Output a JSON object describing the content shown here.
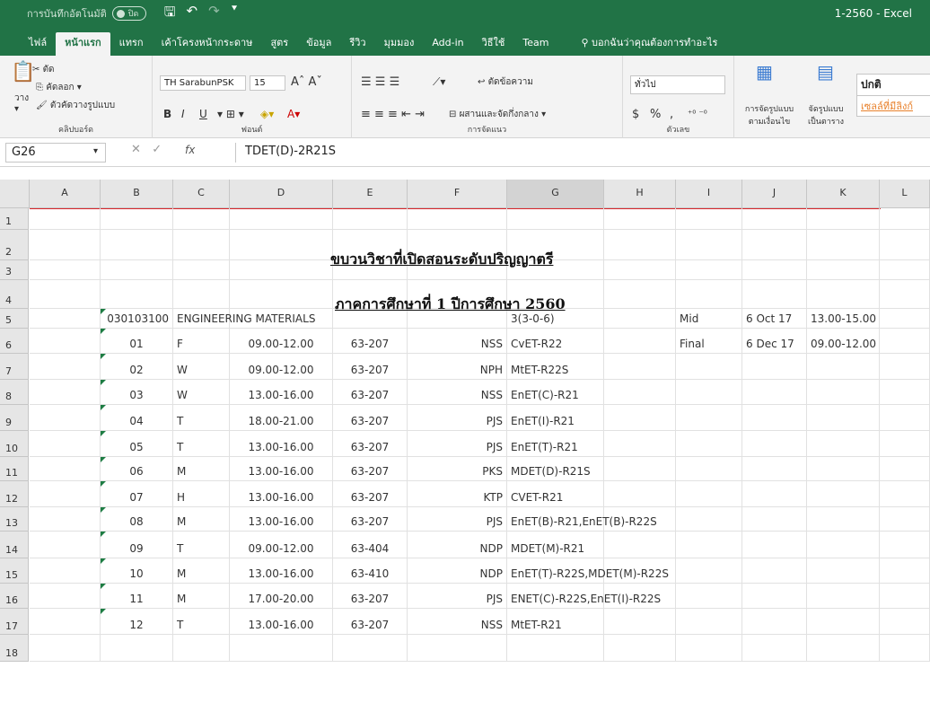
{
  "titlebar": {
    "autosave": "การบันทึกอัตโนมัติ",
    "autosave_state": "ปิด",
    "doc_title": "1-2560  -  Excel"
  },
  "tabs": [
    "ไฟล์",
    "หน้าแรก",
    "แทรก",
    "เค้าโครงหน้ากระดาษ",
    "สูตร",
    "ข้อมูล",
    "รีวิว",
    "มุมมอง",
    "Add-in",
    "วิธีใช้",
    "Team"
  ],
  "tell_me": "บอกฉันว่าคุณต้องการทำอะไร",
  "ribbon": {
    "clipboard": {
      "paste": "วาง",
      "cut": "ตัด",
      "copy": "คัดลอก",
      "format_painter": "ตัวคัดวางรูปแบบ",
      "group": "คลิปบอร์ด"
    },
    "font": {
      "name": "TH SarabunPSK",
      "size": "15",
      "bold": "B",
      "italic": "I",
      "underline": "U",
      "group": "ฟอนต์"
    },
    "alignment": {
      "wrap": "ตัดข้อความ",
      "merge": "ผสานและจัดกึ่งกลาง",
      "group": "การจัดแนว"
    },
    "number": {
      "format": "ทั่วไป",
      "currency": "$",
      "percent": "%",
      "comma": ",",
      "group": "ตัวเลข"
    },
    "styles": {
      "conditional": "การจัดรูปแบบ ตามเงื่อนไข",
      "table": "จัดรูปแบบ เป็นตาราง",
      "normal": "ปกติ",
      "linked": "เซลล์ที่มีลิงก์"
    }
  },
  "formula_bar": {
    "name_box": "G26",
    "formula": "TDET(D)-2R21S"
  },
  "columns": [
    "A",
    "B",
    "C",
    "D",
    "E",
    "F",
    "G",
    "H",
    "I",
    "J",
    "K",
    "L"
  ],
  "rows": [
    "1",
    "2",
    "3",
    "4",
    "5",
    "6",
    "7",
    "8",
    "9",
    "10",
    "11",
    "12",
    "13",
    "14",
    "15",
    "16",
    "17",
    "18"
  ],
  "sheet": {
    "title1": "ขบวนวิชาที่เปิดสอนระดับปริญญาตรี",
    "title2": "ภาคการศึกษาที่ 1 ปีการศึกษา 2560",
    "course": {
      "code": "030103100",
      "name": "ENGINEERING MATERIALS",
      "credit": "3(3-0-6)"
    },
    "exams": [
      {
        "type": "Mid",
        "date": "6 Oct 17",
        "time": "13.00-15.00"
      },
      {
        "type": "Final",
        "date": "6 Dec 17",
        "time": "09.00-12.00"
      }
    ],
    "sections": [
      {
        "sec": "01",
        "day": "F",
        "time": "09.00-12.00",
        "room": "63-207",
        "inst": "NSS",
        "group": "CvET-R22"
      },
      {
        "sec": "02",
        "day": "W",
        "time": "09.00-12.00",
        "room": "63-207",
        "inst": "NPH",
        "group": "MtET-R22S"
      },
      {
        "sec": "03",
        "day": "W",
        "time": "13.00-16.00",
        "room": "63-207",
        "inst": "NSS",
        "group": "EnET(C)-R21"
      },
      {
        "sec": "04",
        "day": "T",
        "time": "18.00-21.00",
        "room": "63-207",
        "inst": "PJS",
        "group": "EnET(I)-R21"
      },
      {
        "sec": "05",
        "day": "T",
        "time": "13.00-16.00",
        "room": "63-207",
        "inst": "PJS",
        "group": "EnET(T)-R21"
      },
      {
        "sec": "06",
        "day": "M",
        "time": "13.00-16.00",
        "room": "63-207",
        "inst": "PKS",
        "group": "MDET(D)-R21S"
      },
      {
        "sec": "07",
        "day": "H",
        "time": "13.00-16.00",
        "room": "63-207",
        "inst": "KTP",
        "group": "CVET-R21"
      },
      {
        "sec": "08",
        "day": "M",
        "time": "13.00-16.00",
        "room": "63-207",
        "inst": "PJS",
        "group": "EnET(B)-R21,EnET(B)-R22S"
      },
      {
        "sec": "09",
        "day": "T",
        "time": "09.00-12.00",
        "room": "63-404",
        "inst": "NDP",
        "group": "MDET(M)-R21"
      },
      {
        "sec": "10",
        "day": "M",
        "time": "13.00-16.00",
        "room": "63-410",
        "inst": "NDP",
        "group": "EnET(T)-R22S,MDET(M)-R22S"
      },
      {
        "sec": "11",
        "day": "M",
        "time": "17.00-20.00",
        "room": "63-207",
        "inst": "PJS",
        "group": "ENET(C)-R22S,EnET(I)-R22S"
      },
      {
        "sec": "12",
        "day": "T",
        "time": "13.00-16.00",
        "room": "63-207",
        "inst": "NSS",
        "group": "MtET-R21"
      }
    ]
  },
  "colors": {
    "excel_green": "#217346",
    "highlight": "#d9262b"
  }
}
